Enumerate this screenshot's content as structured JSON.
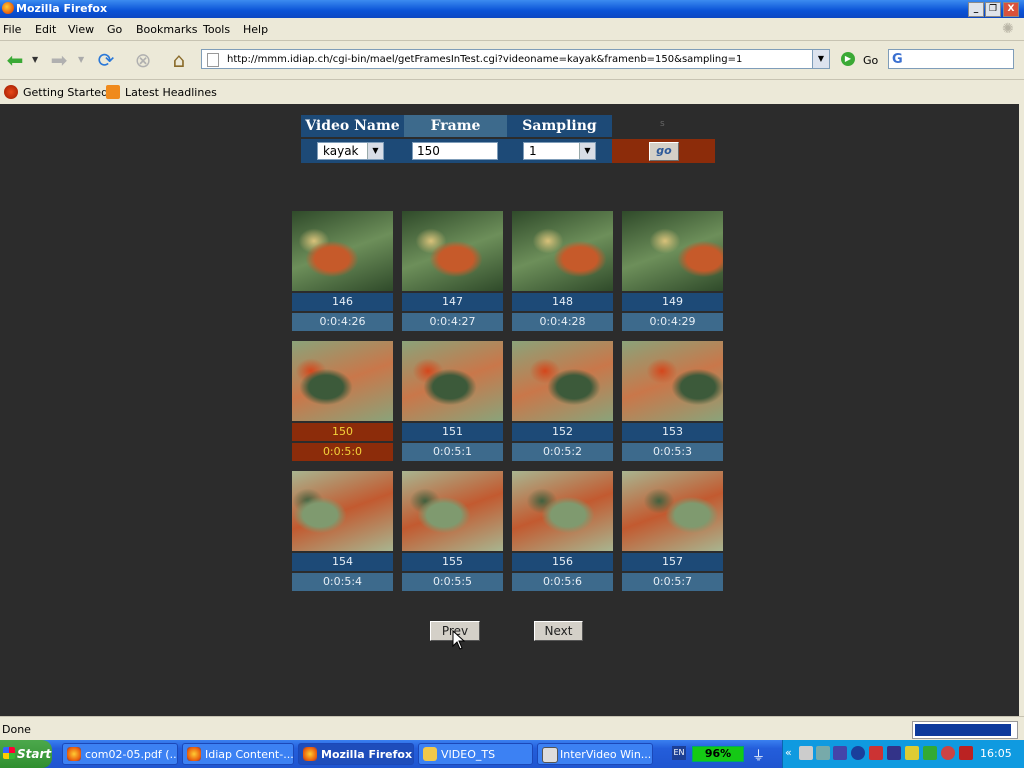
{
  "window": {
    "title": "Mozilla Firefox",
    "controls": [
      "_",
      "❐",
      "X"
    ]
  },
  "menu": [
    "File",
    "Edit",
    "View",
    "Go",
    "Bookmarks",
    "Tools",
    "Help"
  ],
  "nav": {
    "url": "http://mmm.idiap.ch/cgi-bin/mael/getFramesInTest.cgi?videoname=kayak&framenb=150&sampling=1",
    "go_label": "Go",
    "search_value": ""
  },
  "bookmarks": [
    {
      "label": "Getting Started",
      "icon": "firefox-icon"
    },
    {
      "label": "Latest Headlines",
      "icon": "rss-icon"
    }
  ],
  "form": {
    "headers": {
      "video_name": "Video Name",
      "frame": "Frame",
      "sampling": "Sampling",
      "extra": "s"
    },
    "video_name_value": "kayak",
    "frame_value": "150",
    "sampling_value": "1",
    "go_button": "go"
  },
  "frames": [
    {
      "num": "146",
      "time": "0:0:4:26"
    },
    {
      "num": "147",
      "time": "0:0:4:27"
    },
    {
      "num": "148",
      "time": "0:0:4:28"
    },
    {
      "num": "149",
      "time": "0:0:4:29"
    },
    {
      "num": "150",
      "time": "0:0:5:0",
      "selected": true
    },
    {
      "num": "151",
      "time": "0:0:5:1"
    },
    {
      "num": "152",
      "time": "0:0:5:2"
    },
    {
      "num": "153",
      "time": "0:0:5:3"
    },
    {
      "num": "154",
      "time": "0:0:5:4"
    },
    {
      "num": "155",
      "time": "0:0:5:5"
    },
    {
      "num": "156",
      "time": "0:0:5:6"
    },
    {
      "num": "157",
      "time": "0:0:5:7"
    }
  ],
  "pager": {
    "prev": "Prev",
    "next": "Next"
  },
  "status": {
    "text": "Done"
  },
  "taskbar": {
    "start": "Start",
    "tasks": [
      {
        "label": "com02-05.pdf (...",
        "icon": "firefox-icon"
      },
      {
        "label": "Idiap Content-...",
        "icon": "firefox-icon"
      },
      {
        "label": "Mozilla Firefox",
        "icon": "firefox-icon",
        "active": true
      },
      {
        "label": "VIDEO_TS",
        "icon": "folder-icon"
      },
      {
        "label": "InterVideo Win...",
        "icon": "intervideo-icon"
      }
    ],
    "lang": "EN",
    "battery": "96%",
    "clock": "16:05"
  },
  "colors": {
    "page_bg": "#2c2c2c",
    "header_blue": "#3d6a8c",
    "dark_blue": "#1d4a77",
    "selected_red": "#8c2c0a",
    "selected_text": "#f4d23a"
  }
}
